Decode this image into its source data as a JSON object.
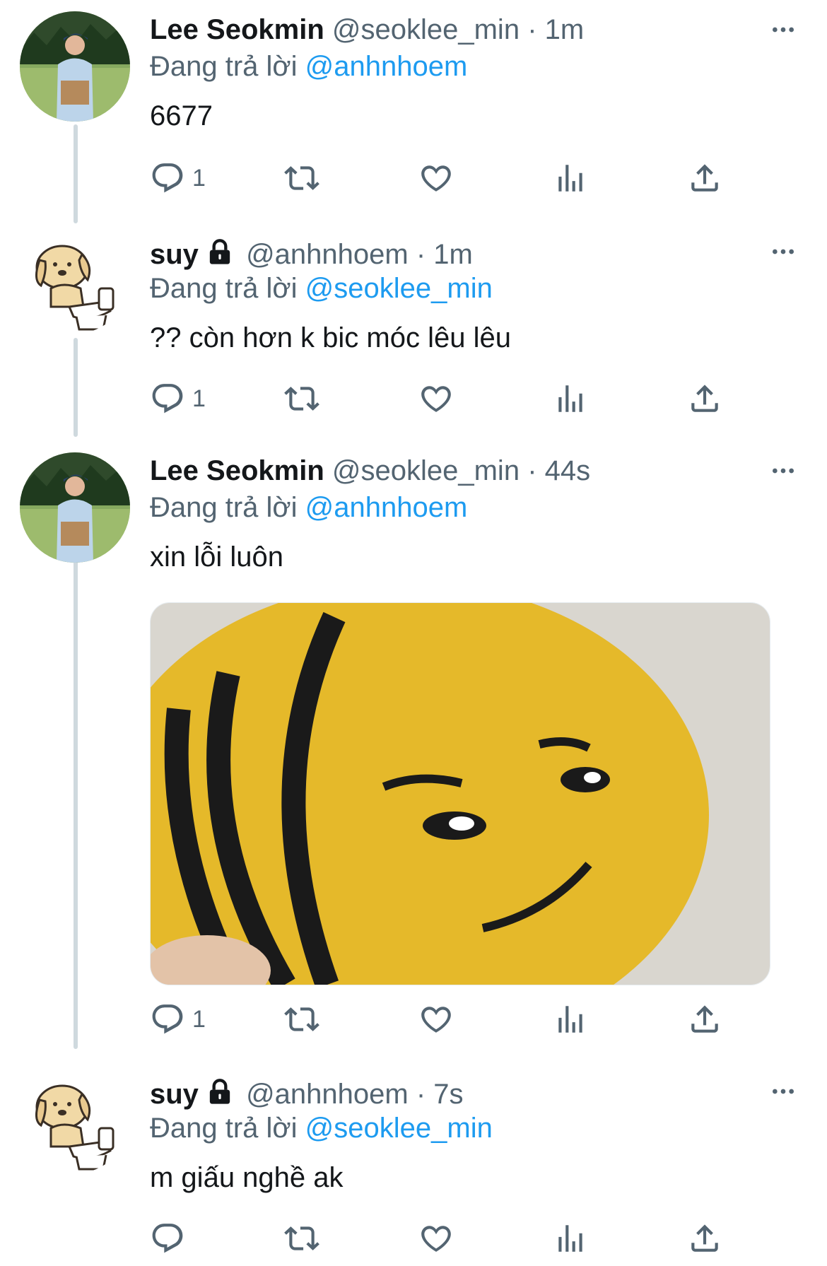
{
  "colors": {
    "accent": "#1d9bf0",
    "secondary_text": "#536471",
    "thread_line": "#cfd9de"
  },
  "tweets": [
    {
      "name": "Lee Seokmin",
      "handle": "@seoklee_min",
      "separator": "·",
      "time": "1m",
      "reply_prefix": "Đang trả lời",
      "reply_to": "@anhnhoem",
      "text": "6677",
      "reply_count": "1",
      "avatar_icon": "person-photo-avatar"
    },
    {
      "name": "suy",
      "handle": "@anhnhoem",
      "separator": "·",
      "time": "1m",
      "reply_prefix": "Đang trả lời",
      "reply_to": "@seoklee_min",
      "text": "?? còn hơn k bic móc lêu lêu",
      "reply_count": "1",
      "avatar_icon": "dog-cartoon-avatar",
      "locked": true
    },
    {
      "name": "Lee Seokmin",
      "handle": "@seoklee_min",
      "separator": "·",
      "time": "44s",
      "reply_prefix": "Đang trả lời",
      "reply_to": "@anhnhoem",
      "text": "xin lỗi luôn",
      "reply_count": "1",
      "avatar_icon": "person-photo-avatar",
      "media": "crochet-bee-image"
    },
    {
      "name": "suy",
      "handle": "@anhnhoem",
      "separator": "·",
      "time": "7s",
      "reply_prefix": "Đang trả lời",
      "reply_to": "@seoklee_min",
      "text": "m giấu nghề ak",
      "reply_count": "",
      "avatar_icon": "dog-cartoon-avatar",
      "locked": true
    }
  ]
}
